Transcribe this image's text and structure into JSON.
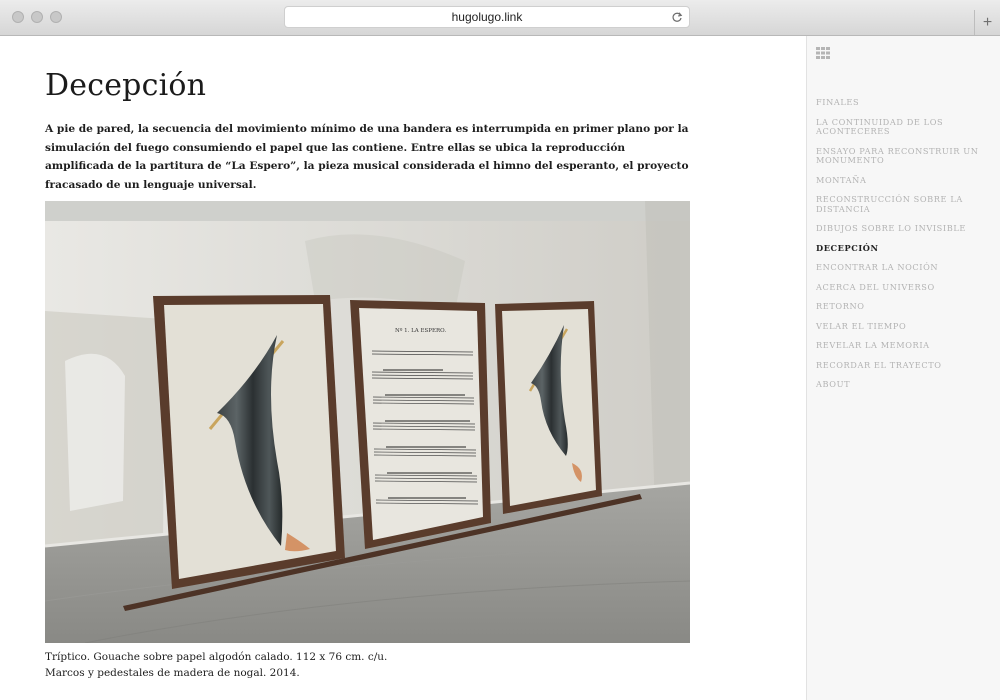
{
  "browser": {
    "url": "hugolugo.link",
    "new_tab_symbol": "+",
    "icons": [
      "reload-icon"
    ]
  },
  "page": {
    "title": "Decepción",
    "lead": "A pie de pared, la secuencia del movimiento mínimo de una bandera es interrumpida en primer plano por la simulación del fuego consumiendo el papel que las contiene. Entre ellas se ubica la reproducción amplificada de la partitura de “La Espero”, la pieza musical considerada el himno del esperanto, el proyecto fracasado de un lenguaje universal.",
    "caption_line1": "Tríptico. Gouache sobre papel algodón calado. 112 x 76 cm. c/u.",
    "caption_line2": "Marcos y pedestales de madera de nogal. 2014.",
    "score_heading": "Nº 1. LA ESPERO."
  },
  "sidebar": {
    "menu_icon": "grid-icon",
    "items": [
      {
        "label": "Finales",
        "active": false
      },
      {
        "label": "La continuidad de los aconteceres",
        "active": false
      },
      {
        "label": "Ensayo para reconstruir un monumento",
        "active": false
      },
      {
        "label": "Montaña",
        "active": false
      },
      {
        "label": "Reconstrucción sobre la distancia",
        "active": false
      },
      {
        "label": "Dibujos sobre lo invisible",
        "active": false
      },
      {
        "label": "Decepción",
        "active": true
      },
      {
        "label": "Encontrar la noción",
        "active": false
      },
      {
        "label": "Acerca del universo",
        "active": false
      },
      {
        "label": "Retorno",
        "active": false
      },
      {
        "label": "Velar el tiempo",
        "active": false
      },
      {
        "label": "Revelar la memoria",
        "active": false
      },
      {
        "label": "Recordar el trayecto",
        "active": false
      },
      {
        "label": "About",
        "active": false
      }
    ]
  },
  "colors": {
    "frame_wood": "#5a3c2c",
    "flag": "#2f3436",
    "active_nav": "#222222",
    "inactive_nav": "#b3b3b3"
  }
}
